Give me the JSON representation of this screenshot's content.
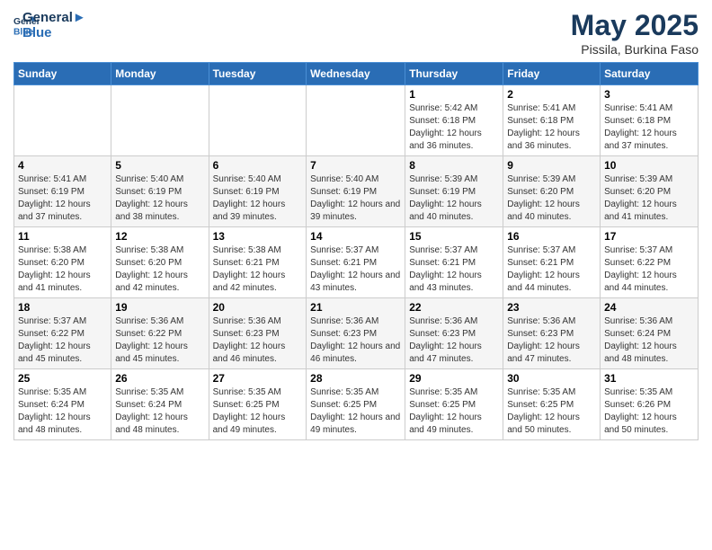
{
  "app": {
    "name": "GeneralBlue",
    "logo_text_1": "General",
    "logo_text_2": "Blue"
  },
  "header": {
    "month_year": "May 2025",
    "location": "Pissila, Burkina Faso"
  },
  "days_of_week": [
    "Sunday",
    "Monday",
    "Tuesday",
    "Wednesday",
    "Thursday",
    "Friday",
    "Saturday"
  ],
  "weeks": [
    [
      {
        "day": "",
        "sunrise": "",
        "sunset": "",
        "daylight": ""
      },
      {
        "day": "",
        "sunrise": "",
        "sunset": "",
        "daylight": ""
      },
      {
        "day": "",
        "sunrise": "",
        "sunset": "",
        "daylight": ""
      },
      {
        "day": "",
        "sunrise": "",
        "sunset": "",
        "daylight": ""
      },
      {
        "day": "1",
        "sunrise": "Sunrise: 5:42 AM",
        "sunset": "Sunset: 6:18 PM",
        "daylight": "Daylight: 12 hours and 36 minutes."
      },
      {
        "day": "2",
        "sunrise": "Sunrise: 5:41 AM",
        "sunset": "Sunset: 6:18 PM",
        "daylight": "Daylight: 12 hours and 36 minutes."
      },
      {
        "day": "3",
        "sunrise": "Sunrise: 5:41 AM",
        "sunset": "Sunset: 6:18 PM",
        "daylight": "Daylight: 12 hours and 37 minutes."
      }
    ],
    [
      {
        "day": "4",
        "sunrise": "Sunrise: 5:41 AM",
        "sunset": "Sunset: 6:19 PM",
        "daylight": "Daylight: 12 hours and 37 minutes."
      },
      {
        "day": "5",
        "sunrise": "Sunrise: 5:40 AM",
        "sunset": "Sunset: 6:19 PM",
        "daylight": "Daylight: 12 hours and 38 minutes."
      },
      {
        "day": "6",
        "sunrise": "Sunrise: 5:40 AM",
        "sunset": "Sunset: 6:19 PM",
        "daylight": "Daylight: 12 hours and 39 minutes."
      },
      {
        "day": "7",
        "sunrise": "Sunrise: 5:40 AM",
        "sunset": "Sunset: 6:19 PM",
        "daylight": "Daylight: 12 hours and 39 minutes."
      },
      {
        "day": "8",
        "sunrise": "Sunrise: 5:39 AM",
        "sunset": "Sunset: 6:19 PM",
        "daylight": "Daylight: 12 hours and 40 minutes."
      },
      {
        "day": "9",
        "sunrise": "Sunrise: 5:39 AM",
        "sunset": "Sunset: 6:20 PM",
        "daylight": "Daylight: 12 hours and 40 minutes."
      },
      {
        "day": "10",
        "sunrise": "Sunrise: 5:39 AM",
        "sunset": "Sunset: 6:20 PM",
        "daylight": "Daylight: 12 hours and 41 minutes."
      }
    ],
    [
      {
        "day": "11",
        "sunrise": "Sunrise: 5:38 AM",
        "sunset": "Sunset: 6:20 PM",
        "daylight": "Daylight: 12 hours and 41 minutes."
      },
      {
        "day": "12",
        "sunrise": "Sunrise: 5:38 AM",
        "sunset": "Sunset: 6:20 PM",
        "daylight": "Daylight: 12 hours and 42 minutes."
      },
      {
        "day": "13",
        "sunrise": "Sunrise: 5:38 AM",
        "sunset": "Sunset: 6:21 PM",
        "daylight": "Daylight: 12 hours and 42 minutes."
      },
      {
        "day": "14",
        "sunrise": "Sunrise: 5:37 AM",
        "sunset": "Sunset: 6:21 PM",
        "daylight": "Daylight: 12 hours and 43 minutes."
      },
      {
        "day": "15",
        "sunrise": "Sunrise: 5:37 AM",
        "sunset": "Sunset: 6:21 PM",
        "daylight": "Daylight: 12 hours and 43 minutes."
      },
      {
        "day": "16",
        "sunrise": "Sunrise: 5:37 AM",
        "sunset": "Sunset: 6:21 PM",
        "daylight": "Daylight: 12 hours and 44 minutes."
      },
      {
        "day": "17",
        "sunrise": "Sunrise: 5:37 AM",
        "sunset": "Sunset: 6:22 PM",
        "daylight": "Daylight: 12 hours and 44 minutes."
      }
    ],
    [
      {
        "day": "18",
        "sunrise": "Sunrise: 5:37 AM",
        "sunset": "Sunset: 6:22 PM",
        "daylight": "Daylight: 12 hours and 45 minutes."
      },
      {
        "day": "19",
        "sunrise": "Sunrise: 5:36 AM",
        "sunset": "Sunset: 6:22 PM",
        "daylight": "Daylight: 12 hours and 45 minutes."
      },
      {
        "day": "20",
        "sunrise": "Sunrise: 5:36 AM",
        "sunset": "Sunset: 6:23 PM",
        "daylight": "Daylight: 12 hours and 46 minutes."
      },
      {
        "day": "21",
        "sunrise": "Sunrise: 5:36 AM",
        "sunset": "Sunset: 6:23 PM",
        "daylight": "Daylight: 12 hours and 46 minutes."
      },
      {
        "day": "22",
        "sunrise": "Sunrise: 5:36 AM",
        "sunset": "Sunset: 6:23 PM",
        "daylight": "Daylight: 12 hours and 47 minutes."
      },
      {
        "day": "23",
        "sunrise": "Sunrise: 5:36 AM",
        "sunset": "Sunset: 6:23 PM",
        "daylight": "Daylight: 12 hours and 47 minutes."
      },
      {
        "day": "24",
        "sunrise": "Sunrise: 5:36 AM",
        "sunset": "Sunset: 6:24 PM",
        "daylight": "Daylight: 12 hours and 48 minutes."
      }
    ],
    [
      {
        "day": "25",
        "sunrise": "Sunrise: 5:35 AM",
        "sunset": "Sunset: 6:24 PM",
        "daylight": "Daylight: 12 hours and 48 minutes."
      },
      {
        "day": "26",
        "sunrise": "Sunrise: 5:35 AM",
        "sunset": "Sunset: 6:24 PM",
        "daylight": "Daylight: 12 hours and 48 minutes."
      },
      {
        "day": "27",
        "sunrise": "Sunrise: 5:35 AM",
        "sunset": "Sunset: 6:25 PM",
        "daylight": "Daylight: 12 hours and 49 minutes."
      },
      {
        "day": "28",
        "sunrise": "Sunrise: 5:35 AM",
        "sunset": "Sunset: 6:25 PM",
        "daylight": "Daylight: 12 hours and 49 minutes."
      },
      {
        "day": "29",
        "sunrise": "Sunrise: 5:35 AM",
        "sunset": "Sunset: 6:25 PM",
        "daylight": "Daylight: 12 hours and 49 minutes."
      },
      {
        "day": "30",
        "sunrise": "Sunrise: 5:35 AM",
        "sunset": "Sunset: 6:25 PM",
        "daylight": "Daylight: 12 hours and 50 minutes."
      },
      {
        "day": "31",
        "sunrise": "Sunrise: 5:35 AM",
        "sunset": "Sunset: 6:26 PM",
        "daylight": "Daylight: 12 hours and 50 minutes."
      }
    ]
  ]
}
